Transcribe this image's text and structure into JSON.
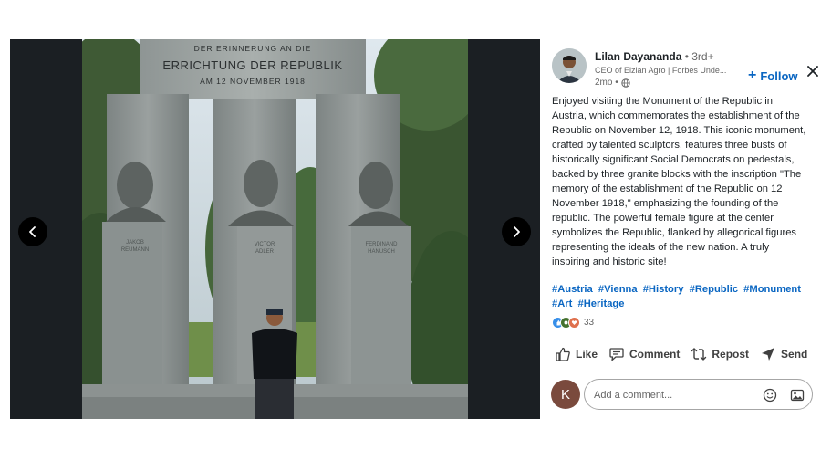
{
  "photo": {
    "inscription": {
      "line1": "DER ERINNERUNG AN DIE",
      "line2": "ERRICHTUNG DER REPUBLIK",
      "line3": "AM 12 NOVEMBER 1918"
    },
    "bust_labels": {
      "left": [
        "JAKOB",
        "REUMANN"
      ],
      "center": [
        "VICTOR",
        "ADLER"
      ],
      "right": [
        "FERDINAND",
        "HANUSCH"
      ]
    }
  },
  "author": {
    "name": "Lilan Dayananda",
    "degree": " • 3rd+",
    "headline": "CEO of Elzian Agro | Forbes Unde...",
    "time": "2mo •",
    "follow_label": "Follow",
    "follow_plus": "+"
  },
  "post": {
    "text": "Enjoyed visiting the Monument of the Republic in Austria, which commemorates the establishment of the Republic on November 12, 1918. This iconic monument, crafted by talented sculptors, features three busts of historically significant Social Democrats on pedestals, backed by three granite blocks with the inscription \"The memory of the establishment of the Republic on 12 November 1918,\" emphasizing the founding of the republic. The powerful female figure at the center symbolizes the Republic, flanked by allegorical figures representing the ideals of the new nation. A truly inspiring and historic site!",
    "hashtags": [
      "#Austria",
      "#Vienna",
      "#History",
      "#Republic",
      "#Monument",
      "#Art",
      "#Heritage"
    ]
  },
  "reactions": {
    "count": "33",
    "colors": {
      "like": "#378fe9",
      "celebrate": "#44712e",
      "love": "#df704d"
    }
  },
  "actions": {
    "like": "Like",
    "comment": "Comment",
    "repost": "Repost",
    "send": "Send"
  },
  "comment": {
    "avatar_letter": "K",
    "placeholder": "Add a comment..."
  },
  "colors": {
    "link": "#0a66c2",
    "text": "#1d2226",
    "muted": "#666666",
    "viewer_bg": "#1b1f23"
  }
}
